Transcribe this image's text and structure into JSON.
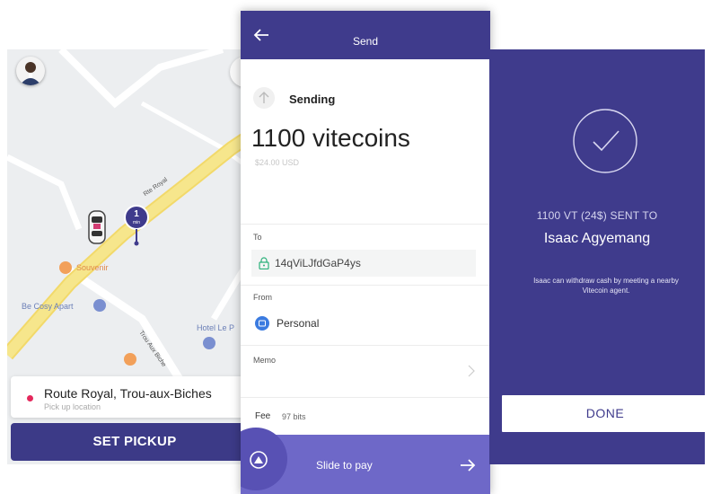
{
  "colors": {
    "primary": "#3f3b8c",
    "slide_bar": "#6e68c8",
    "map_bg": "#eceef0",
    "road_yellow": "#f4e27a",
    "pickup_dot": "#e4285c"
  },
  "map": {
    "avatar_icon": "user-avatar",
    "eta": {
      "value": "1",
      "unit": "min"
    },
    "road_label": "Rte Royal",
    "poi_souvenir": "Souvenir",
    "poi_becosy": "Be Cosy Apart",
    "poi_hotel": "Hotel Le P",
    "street_trou": "Trou Aux Biche",
    "location": {
      "address": "Route Royal, Trou-aux-Biches",
      "sublabel": "Pick up location"
    },
    "set_pickup_label": "SET PICKUP"
  },
  "send": {
    "header_title": "Send",
    "status_label": "Sending",
    "amount": "1100 vitecoins",
    "amount_usd": "$24.00 USD",
    "to_label": "To",
    "to_address": "14qViLJfdGaP4ys",
    "from_label": "From",
    "from_wallet": "Personal",
    "memo_label": "Memo",
    "fee_label": "Fee",
    "fee_value": "97 bits",
    "slide_label": "Slide to pay"
  },
  "confirm": {
    "sent_line": "1100 VT (24$) SENT TO",
    "recipient": "Isaac Agyemang",
    "note": "Isaac can withdraw cash by meeting a nearby Vitecoin agent.",
    "done_label": "DONE"
  }
}
